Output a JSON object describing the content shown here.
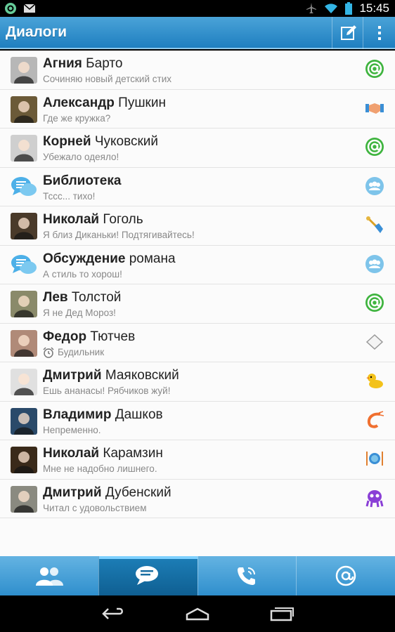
{
  "status_bar": {
    "time": "15:45",
    "icons": [
      "at-notification-icon",
      "mail-icon",
      "airplane-icon",
      "wifi-icon",
      "battery-icon"
    ]
  },
  "action_bar": {
    "title": "Диалоги",
    "compose_icon": "compose-icon",
    "menu_icon": "overflow-menu-icon"
  },
  "dialogs": [
    {
      "first": "Агния",
      "last": "Барто",
      "message": "Сочиняю новый детский стих",
      "status": "at-status-icon",
      "avatar_bg": "#b7b7b7"
    },
    {
      "first": "Александр",
      "last": "Пушкин",
      "message": "Где же кружка?",
      "status": "handshake-icon",
      "avatar_bg": "#6b5a38"
    },
    {
      "first": "Корней",
      "last": "Чуковский",
      "message": "Убежало одеяло!",
      "status": "at-status-icon",
      "avatar_bg": "#cfcfcf"
    },
    {
      "first": "Библиотека",
      "last": "",
      "message": "Тссс... тихо!",
      "status": "group-icon",
      "avatar_bg": "chat"
    },
    {
      "first": "Николай",
      "last": "Гоголь",
      "message": "Я близ Диканьки! Подтягивайтесь!",
      "status": "shovel-icon",
      "avatar_bg": "#4a3a2a"
    },
    {
      "first": "Обсуждение",
      "last": "романа",
      "message": "А стиль то хорош!",
      "status": "group-icon",
      "avatar_bg": "chat"
    },
    {
      "first": "Лев",
      "last": "Толстой",
      "message": "Я не Дед Мороз!",
      "status": "at-status-icon",
      "avatar_bg": "#8a8a6a"
    },
    {
      "first": "Федор",
      "last": "Тютчев",
      "message": "Будильник",
      "status": "pillow-icon",
      "avatar_bg": "#b08a78",
      "message_icon": "alarm-clock-icon"
    },
    {
      "first": "Дмитрий",
      "last": "Маяковский",
      "message": "Ешь ананасы! Рябчиков жуй!",
      "status": "duck-icon",
      "avatar_bg": "#e0e0e0"
    },
    {
      "first": "Владимир",
      "last": "Дашков",
      "message": "Непременно.",
      "status": "shrimp-icon",
      "avatar_bg": "#2a4a6a"
    },
    {
      "first": "Николай",
      "last": "Карамзин",
      "message": "Мне не надобно лишнего.",
      "status": "plate-icon",
      "avatar_bg": "#3a2a1a"
    },
    {
      "first": "Дмитрий",
      "last": "Дубенский",
      "message": "Читал с удовольствием",
      "status": "octopus-icon",
      "avatar_bg": "#8a8a80"
    }
  ],
  "tabs": [
    {
      "icon": "contacts-icon",
      "active": false
    },
    {
      "icon": "chat-icon",
      "active": true
    },
    {
      "icon": "calls-icon",
      "active": false
    },
    {
      "icon": "at-icon",
      "active": false
    }
  ],
  "nav": [
    "back-icon",
    "home-icon",
    "recent-apps-icon"
  ]
}
